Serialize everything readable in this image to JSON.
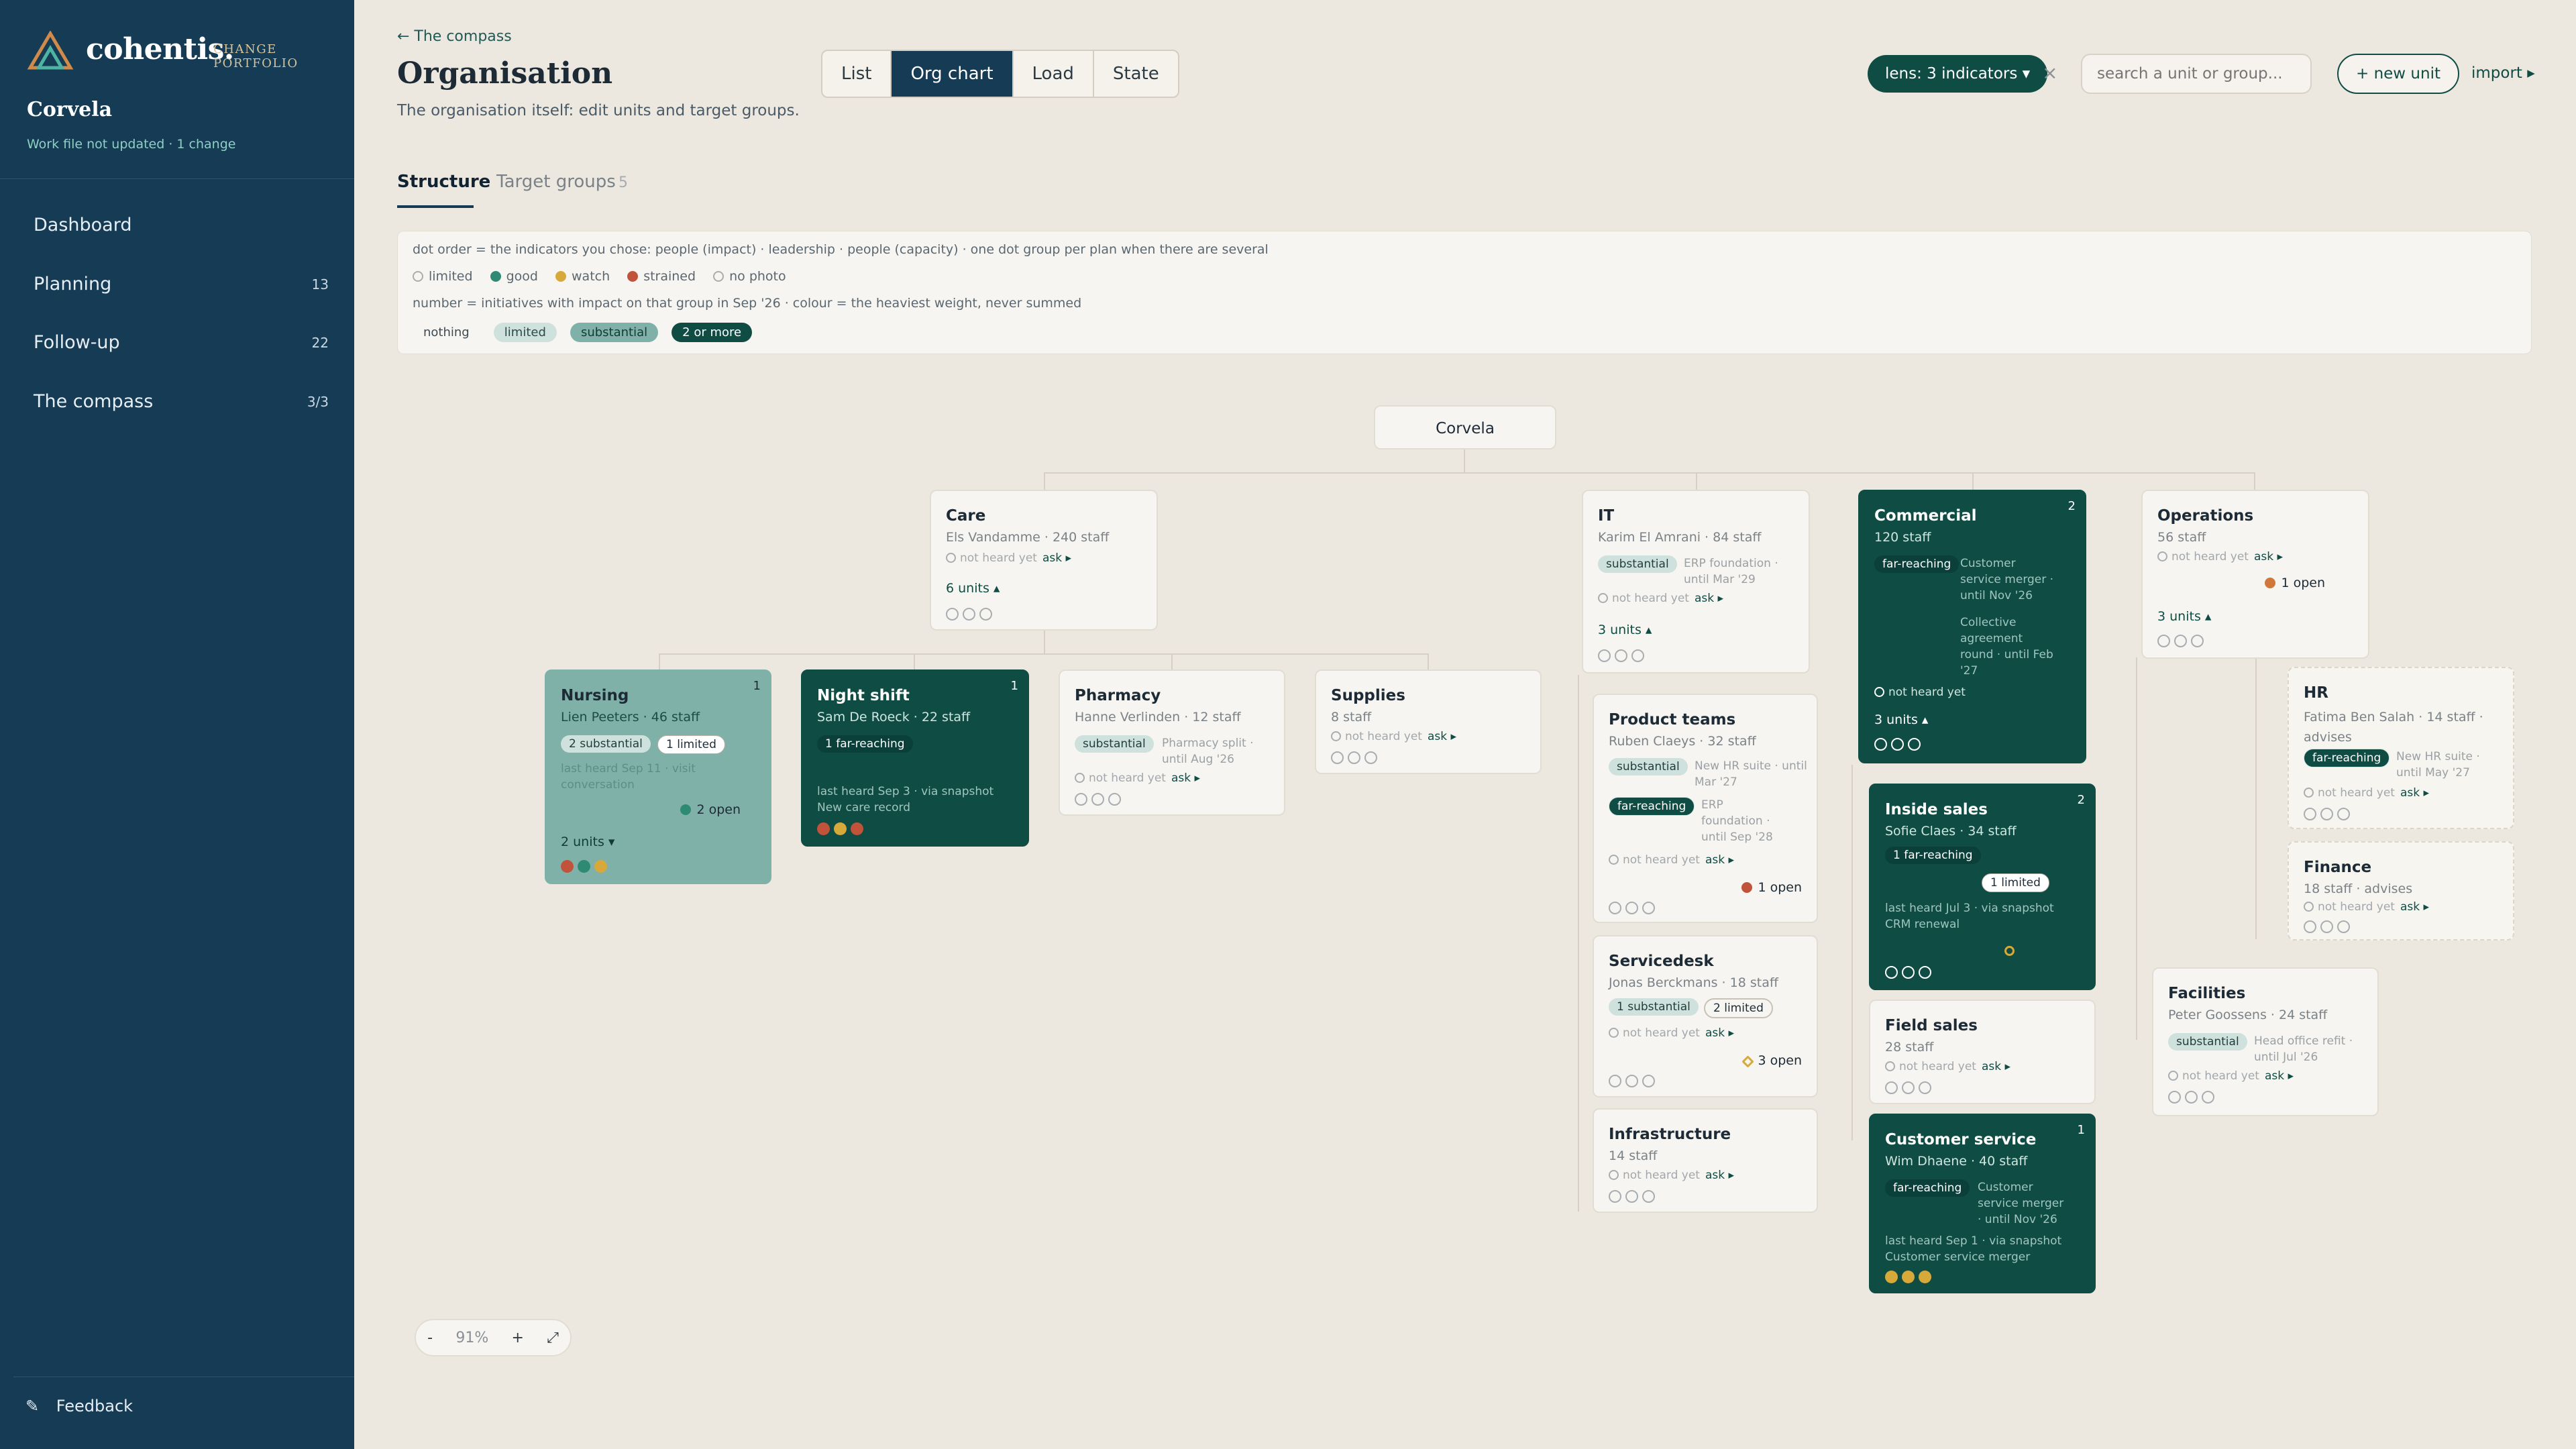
{
  "sidebar": {
    "brand": "cohentis.",
    "brand_sub": "CHANGE PORTFOLIO",
    "org": "Corvela",
    "workfile": "Work file not updated · 1 change",
    "nav": [
      {
        "label": "Dashboard",
        "count": ""
      },
      {
        "label": "Planning",
        "count": "13"
      },
      {
        "label": "Follow-up",
        "count": "22"
      },
      {
        "label": "The compass",
        "count": "3/3"
      }
    ],
    "feedback_icon": "✎",
    "feedback": "Feedback"
  },
  "header": {
    "back": "← The compass",
    "title": "Organisation",
    "subtitle": "The organisation itself: edit units and target groups.",
    "views": [
      "List",
      "Org chart",
      "Load",
      "State"
    ],
    "active_view": "Org chart",
    "lens": "lens: 3 indicators ▾",
    "lens_clear": "×",
    "search_placeholder": "search a unit or group...",
    "new_unit": "+ new unit",
    "import": "import ▸"
  },
  "subtabs": {
    "structure": "Structure",
    "target": "Target groups",
    "target_count": "5"
  },
  "legend": {
    "line1": "dot order = the indicators you chose: people (impact) · leadership · people (capacity) · one dot group per plan when there are several",
    "states": [
      {
        "label": "limited",
        "color": "none"
      },
      {
        "label": "good",
        "color": "#2e8a73"
      },
      {
        "label": "watch",
        "color": "#d6a93a"
      },
      {
        "label": "strained",
        "color": "#c0533a"
      },
      {
        "label": "no photo",
        "color": "none"
      }
    ],
    "line3": "number = initiatives with impact on that group in Sep '26 · colour = the heaviest weight, never summed",
    "weights": [
      "nothing",
      "limited",
      "substantial",
      "2 or more"
    ]
  },
  "root": {
    "name": "Corvela"
  },
  "cards": {
    "care": {
      "title": "Care",
      "sub": "Els Vandamme · 240 staff",
      "heard": "not heard yet",
      "ask": "ask ▸",
      "units": "6 units ▴"
    },
    "nursing": {
      "title": "Nursing",
      "sub": "Lien Peeters · 46 staff",
      "badge": "1",
      "chip1": "2 substantial",
      "chip2": "1 limited",
      "note": "last heard Sep 11 · visit conversation",
      "open": "2 open",
      "units": "2 units ▾"
    },
    "night": {
      "title": "Night shift",
      "sub": "Sam De Roeck · 22 staff",
      "badge": "1",
      "chip1": "1 far-reaching",
      "note1": "last heard Sep 3 · via snapshot",
      "note2": "New care record"
    },
    "pharmacy": {
      "title": "Pharmacy",
      "sub": "Hanne Verlinden · 12 staff",
      "chip1": "substantial",
      "note": "Pharmacy split · until Aug '26",
      "heard": "not heard yet",
      "ask": "ask ▸"
    },
    "supplies": {
      "title": "Supplies",
      "sub": "8 staff",
      "heard": "not heard yet",
      "ask": "ask ▸"
    },
    "it": {
      "title": "IT",
      "sub": "Karim El Amrani · 84 staff",
      "chip1": "substantial",
      "note": "ERP foundation · until Mar '29",
      "heard": "not heard yet",
      "ask": "ask ▸",
      "units": "3 units ▴"
    },
    "product": {
      "title": "Product teams",
      "sub": "Ruben Claeys · 32 staff",
      "chip1": "substantial",
      "note1": "New HR suite · until Mar '27",
      "chip2": "far-reaching",
      "note2": "ERP foundation · until Sep '28",
      "heard": "not heard yet",
      "ask": "ask ▸",
      "open": "1 open"
    },
    "servicedesk": {
      "title": "Servicedesk",
      "sub": "Jonas Berckmans · 18 staff",
      "chip1": "1 substantial",
      "chip2": "2 limited",
      "heard": "not heard yet",
      "ask": "ask ▸",
      "open": "3 open"
    },
    "infra": {
      "title": "Infrastructure",
      "sub": "14 staff",
      "heard": "not heard yet",
      "ask": "ask ▸"
    },
    "commercial": {
      "title": "Commercial",
      "sub": "120 staff",
      "badge": "2",
      "chip1": "far-reaching",
      "note1": "Customer service merger · until Nov '26",
      "note2": "Collective agreement round · until Feb '27",
      "heard": "not heard yet",
      "units": "3 units ▴"
    },
    "inside": {
      "title": "Inside sales",
      "sub": "Sofie Claes · 34 staff",
      "badge": "2",
      "chip1": "1 far-reaching",
      "chip2": "1 limited",
      "note1": "last heard Jul 3 · via snapshot",
      "note2": "CRM renewal"
    },
    "field": {
      "title": "Field sales",
      "sub": "28 staff",
      "heard": "not heard yet",
      "ask": "ask ▸"
    },
    "customer": {
      "title": "Customer service",
      "sub": "Wim Dhaene · 40 staff",
      "badge": "1",
      "chip1": "far-reaching",
      "note1": "Customer service merger · until Nov '26",
      "note2": "last heard Sep 1 · via snapshot",
      "note3": "Customer service merger"
    },
    "operations": {
      "title": "Operations",
      "sub": "56 staff",
      "heard": "not heard yet",
      "ask": "ask ▸",
      "open": "1 open",
      "units": "3 units ▴"
    },
    "hr": {
      "title": "HR",
      "sub": "Fatima Ben Salah · 14 staff · advises",
      "chip1": "far-reaching",
      "note": "New HR suite · until May '27",
      "heard": "not heard yet",
      "ask": "ask ▸"
    },
    "finance": {
      "title": "Finance",
      "sub": "18 staff · advises",
      "heard": "not heard yet",
      "ask": "ask ▸"
    },
    "facilities": {
      "title": "Facilities",
      "sub": "Peter Goossens · 24 staff",
      "chip1": "substantial",
      "note": "Head office refit · until Jul '26",
      "heard": "not heard yet",
      "ask": "ask ▸"
    }
  },
  "zoom": {
    "minus": "-",
    "level": "91%",
    "plus": "+",
    "fit_icon": "⤢"
  },
  "colors": {
    "sidebar": "#163b55",
    "accent": "#0e4c44",
    "good": "#2e8a73",
    "watch": "#d6a93a",
    "strained": "#c0533a"
  }
}
